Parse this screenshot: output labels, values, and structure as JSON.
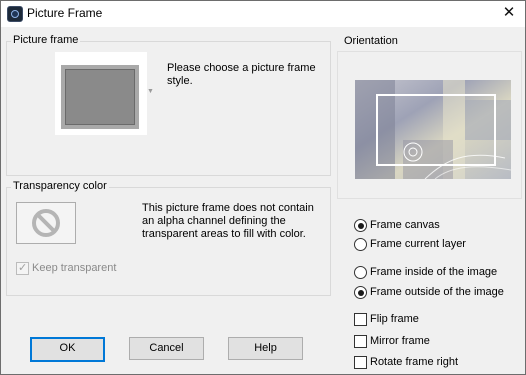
{
  "window": {
    "title": "Picture Frame",
    "close_glyph": "✕"
  },
  "picture_frame": {
    "group_label": "Picture frame",
    "prompt": [
      "Please choose a picture frame",
      "style."
    ]
  },
  "transparency": {
    "group_label": "Transparency color",
    "description": [
      "This picture frame does not contain",
      "an alpha channel defining the",
      "transparent areas to fill with color."
    ],
    "keep_transparent": {
      "label": "Keep transparent",
      "checked": true,
      "disabled": true
    }
  },
  "orientation": {
    "label": "Orientation",
    "radios_target": [
      {
        "label": "Frame canvas",
        "selected": true
      },
      {
        "label": "Frame current layer",
        "selected": false
      }
    ],
    "radios_position": [
      {
        "label": "Frame inside of the image",
        "selected": false
      },
      {
        "label": "Frame outside of the image",
        "selected": true
      }
    ],
    "checkboxes": [
      {
        "label": "Flip frame",
        "checked": false
      },
      {
        "label": "Mirror frame",
        "checked": false
      },
      {
        "label": "Rotate frame right",
        "checked": false
      }
    ]
  },
  "buttons": {
    "ok": "OK",
    "cancel": "Cancel",
    "help": "Help"
  },
  "icons": {
    "app": "app-icon",
    "close": "close-icon",
    "no_symbol": "no-symbol-icon",
    "dropdown": "dropdown-arrow-icon"
  }
}
